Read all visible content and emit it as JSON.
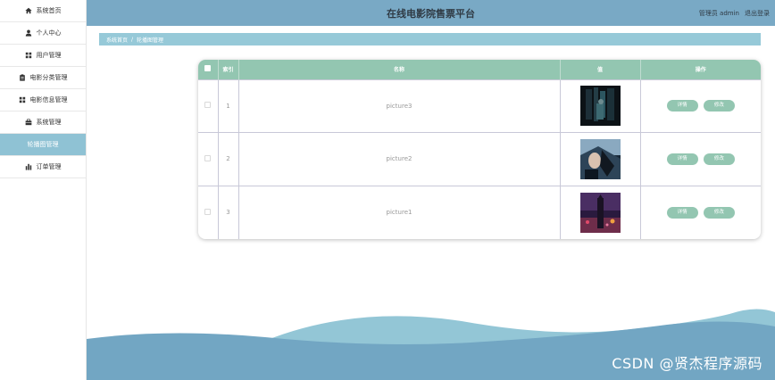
{
  "sidebar": {
    "items": [
      {
        "label": "系统首页",
        "icon": "home-icon"
      },
      {
        "label": "个人中心",
        "icon": "user-icon"
      },
      {
        "label": "用户管理",
        "icon": "grid-icon"
      },
      {
        "label": "电影分类管理",
        "icon": "clipboard-icon"
      },
      {
        "label": "电影信息管理",
        "icon": "grid-icon"
      },
      {
        "label": "系统管理",
        "icon": "briefcase-icon"
      },
      {
        "label": "轮播图管理",
        "icon": "",
        "active": true
      },
      {
        "label": "订单管理",
        "icon": "chart-icon"
      }
    ]
  },
  "header": {
    "title": "在线电影院售票平台",
    "user_label": "管理员 admin",
    "logout_label": "退出登录"
  },
  "breadcrumb": {
    "home": "系统首页",
    "separator": "/",
    "current": "轮播图管理"
  },
  "table": {
    "headers": {
      "index": "索引",
      "name": "名称",
      "value": "值",
      "actions": "操作"
    },
    "rows": [
      {
        "index": "1",
        "name": "picture3"
      },
      {
        "index": "2",
        "name": "picture2"
      },
      {
        "index": "3",
        "name": "picture1"
      }
    ],
    "detail_label": "详情",
    "edit_label": "修改"
  },
  "colors": {
    "header_bg": "#79a9c5",
    "breadcrumb_bg": "#96c9d8",
    "table_header_bg": "#93c6b1",
    "button_bg": "#93c6b1",
    "active_menu_bg": "#8fc2d4",
    "wave_light": "#93c6d6",
    "wave_dark": "#72a6c3"
  },
  "watermark": "CSDN @贤杰程序源码"
}
